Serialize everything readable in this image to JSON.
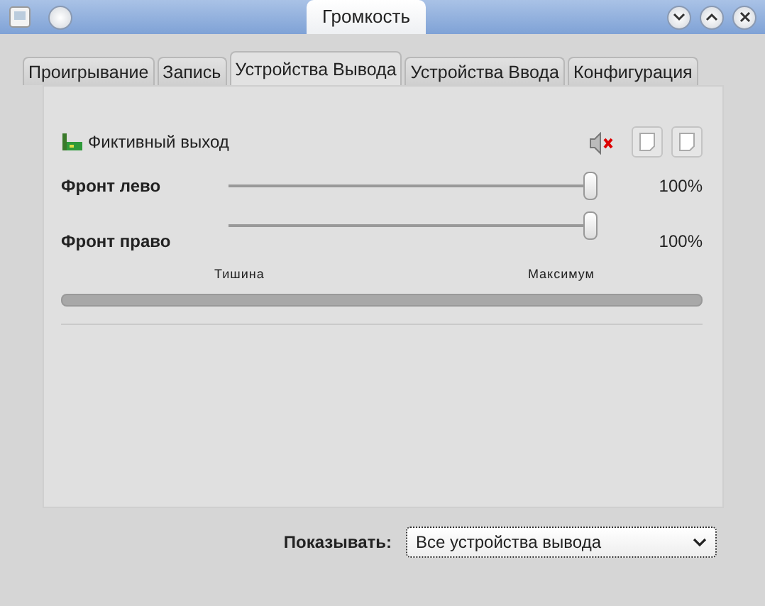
{
  "window": {
    "title": "Громкость"
  },
  "tabs": [
    {
      "label": "Проигрывание",
      "selected": false
    },
    {
      "label": "Запись",
      "selected": false
    },
    {
      "label": "Устройства Вывода",
      "selected": true
    },
    {
      "label": "Устройства Ввода",
      "selected": false
    },
    {
      "label": "Конфигурация",
      "selected": false
    }
  ],
  "device": {
    "name": "Фиктивный выход",
    "muted": true
  },
  "channels": [
    {
      "name": "Фронт лево",
      "level": 1,
      "reading": "100%"
    },
    {
      "name": "Фронт право",
      "level": 1,
      "reading": "100%"
    }
  ],
  "scale": {
    "min_label": "Тишина",
    "max_label": "Максимум"
  },
  "show": {
    "label": "Показывать:",
    "value": "Все устройства вывода"
  }
}
